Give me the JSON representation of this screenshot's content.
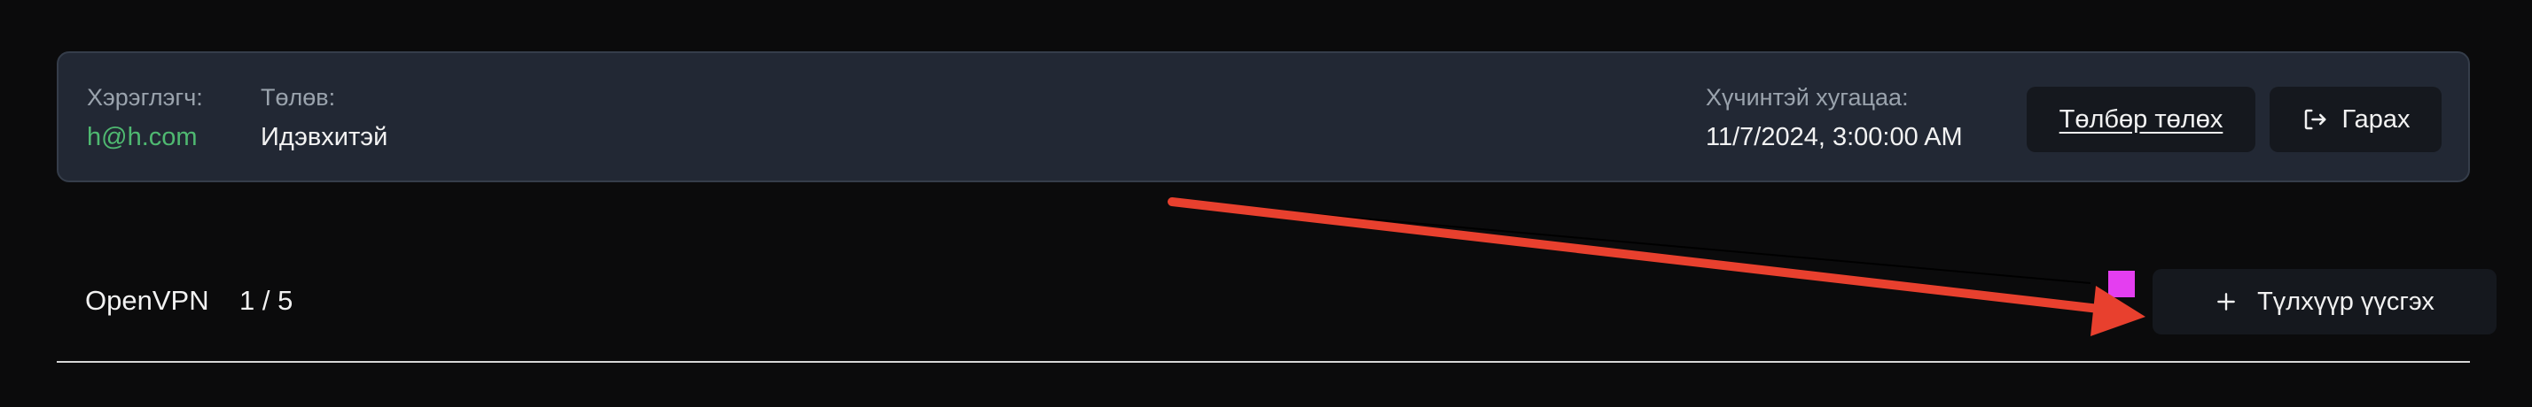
{
  "account": {
    "user_label": "Хэрэглэгч:",
    "user_value": "h@h.com",
    "status_label": "Төлөв:",
    "status_value": "Идэвхитэй",
    "expiry_label": "Хүчинтэй хугацаа:",
    "expiry_value": "11/7/2024, 3:00:00 AM"
  },
  "actions": {
    "pay_label": "Төлбөр төлөх",
    "logout_label": "Гарах",
    "logout_icon": "logout-icon"
  },
  "section": {
    "title": "OpenVPN",
    "count": "1 / 5",
    "add_label": "Түлхүүр үүсгэх",
    "add_icon": "plus-icon"
  },
  "colors": {
    "background": "#0b0b0c",
    "card": "#222834",
    "email": "#4fb971",
    "button": "#15181e",
    "marker": "#e43ef0",
    "arrow": "#e8402e"
  }
}
